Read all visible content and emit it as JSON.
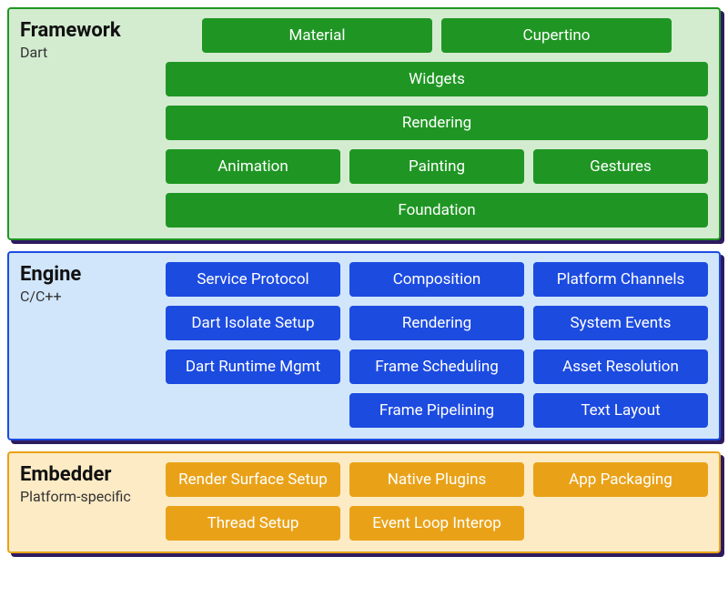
{
  "layers": {
    "framework": {
      "title": "Framework",
      "subtitle": "Dart",
      "row0": {
        "material": "Material",
        "cupertino": "Cupertino"
      },
      "row1": {
        "widgets": "Widgets"
      },
      "row2": {
        "rendering": "Rendering"
      },
      "row3": {
        "animation": "Animation",
        "painting": "Painting",
        "gestures": "Gestures"
      },
      "row4": {
        "foundation": "Foundation"
      }
    },
    "engine": {
      "title": "Engine",
      "subtitle": "C/C++",
      "r0": {
        "c0": "Service Protocol",
        "c1": "Composition",
        "c2": "Platform Channels"
      },
      "r1": {
        "c0": "Dart Isolate Setup",
        "c1": "Rendering",
        "c2": "System Events"
      },
      "r2": {
        "c0": "Dart Runtime Mgmt",
        "c1": "Frame Scheduling",
        "c2": "Asset Resolution"
      },
      "r3": {
        "c1": "Frame Pipelining",
        "c2": "Text Layout"
      }
    },
    "embedder": {
      "title": "Embedder",
      "subtitle": "Platform-specific",
      "r0": {
        "c0": "Render Surface Setup",
        "c1": "Native Plugins",
        "c2": "App Packaging"
      },
      "r1": {
        "c0": "Thread Setup",
        "c1": "Event Loop Interop"
      }
    }
  }
}
